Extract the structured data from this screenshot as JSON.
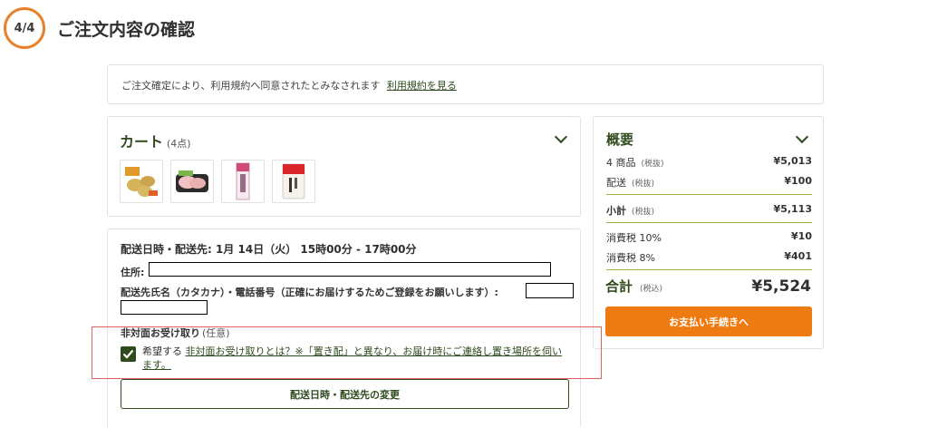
{
  "header": {
    "step": "4/4",
    "title": "ご注文内容の確認"
  },
  "notice": {
    "text": "ご注文確定により、利用規約へ同意されたとみなされます",
    "link": "利用規約を見る"
  },
  "cart": {
    "title": "カート",
    "count": "(4点)",
    "items": [
      {
        "icon": "potato-snack-thumbnail"
      },
      {
        "icon": "chicken-meat-thumbnail"
      },
      {
        "icon": "noodle-package-thumbnail"
      },
      {
        "icon": "rice-bag-thumbnail"
      }
    ]
  },
  "delivery": {
    "title": "配送日時・配送先: 1月 14日（火） 15時00分 - 17時00分",
    "address_label": "住所:",
    "name_label": "配送先氏名（カタカナ）・電話番号（正確にお届けするためご登録をお願いします）:",
    "option_title": "非対面お受け取り",
    "option_note": "(任意)",
    "checkbox_checked": true,
    "checkbox_prefix": "希望する",
    "checkbox_link": "非対面お受け取りとは？※「置き配」と異なり、お届け時にご連絡し置き場所を伺います。",
    "change_button": "配送日時・配送先の変更"
  },
  "summary": {
    "title": "概要",
    "rows": [
      {
        "label": "4 商品",
        "note": "(税抜)",
        "value": "¥5,013"
      },
      {
        "label": "配送",
        "note": "(税抜)",
        "value": "¥100"
      },
      {
        "label": "小計",
        "note": "(税抜)",
        "value": "¥5,113"
      },
      {
        "label": "消費税 10%",
        "note": "",
        "value": "¥10"
      },
      {
        "label": "消費税 8%",
        "note": "",
        "value": "¥401"
      }
    ],
    "total_label": "合計",
    "total_note": "(税込)",
    "total_value": "¥5,524",
    "pay_button": "お支払い手続きへ"
  },
  "colors": {
    "accent": "#2f4a1c",
    "orange": "#ee7a12",
    "step_ring": "#e8822a",
    "highlight": "#e06060"
  }
}
